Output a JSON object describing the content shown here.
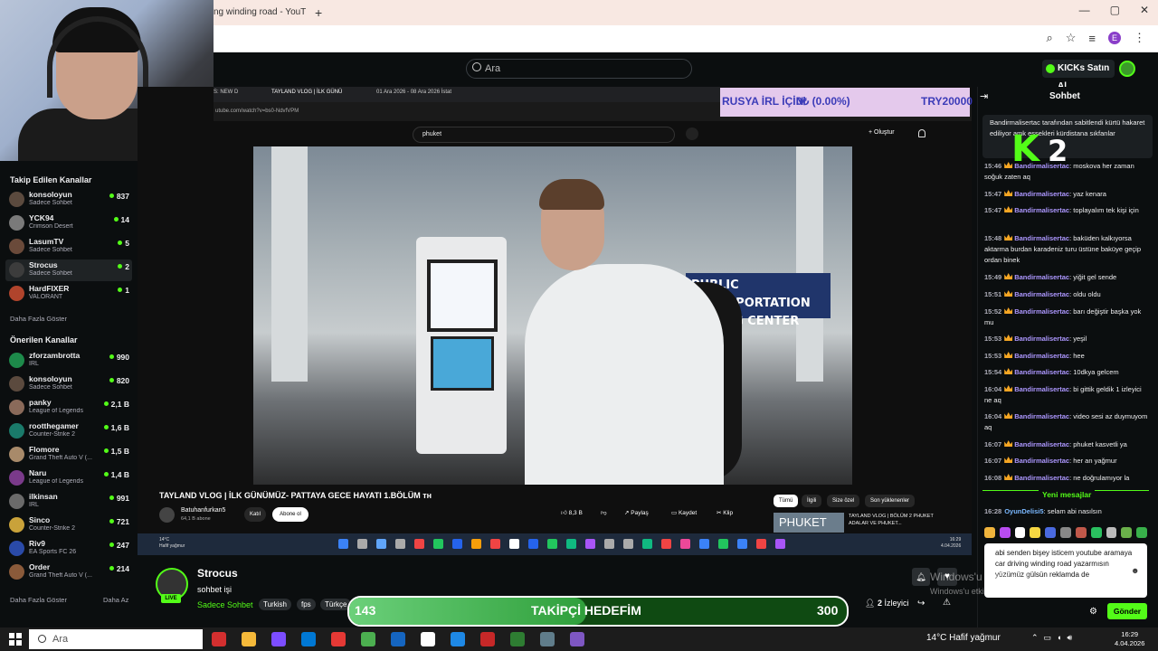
{
  "browser": {
    "tab_title": "ng winding road - YouT",
    "tab_close": "×",
    "new_tab": "+",
    "controls": [
      "—",
      "▢",
      "✕"
    ],
    "profile_initial": "E"
  },
  "kick": {
    "search_placeholder": "Ara",
    "kicks_button": "KICKs Satın Al"
  },
  "sidebar": {
    "followed_heading": "Takip Edilen Kanallar",
    "followed": [
      {
        "name": "konsoloyun",
        "category": "Sadece Sohbet",
        "viewers": "837",
        "color": "#5b4a3e"
      },
      {
        "name": "YCK94",
        "category": "Crimson Desert",
        "viewers": "14",
        "color": "#7a7a7a"
      },
      {
        "name": "LasumTV",
        "category": "Sadece Sohbet",
        "viewers": "5",
        "color": "#6a4a3a"
      },
      {
        "name": "Strocus",
        "category": "Sadece Sohbet",
        "viewers": "2",
        "color": "#3c3c3c"
      },
      {
        "name": "HardFIXER",
        "category": "VALORANT",
        "viewers": "1",
        "color": "#b0442c"
      }
    ],
    "show_more": "Daha Fazla Göster",
    "recommended_heading": "Önerilen Kanallar",
    "recommended": [
      {
        "name": "zforzambrotta",
        "category": "IRL",
        "viewers": "990",
        "color": "#1d8a4a"
      },
      {
        "name": "konsoloyun",
        "category": "Sadece Sohbet",
        "viewers": "820",
        "color": "#5b4a3e"
      },
      {
        "name": "panky",
        "category": "League of Legends",
        "viewers": "2,1 B",
        "color": "#8a6a5a"
      },
      {
        "name": "rootthegamer",
        "category": "Counter-Strike 2",
        "viewers": "1,6 B",
        "color": "#1a7a6a"
      },
      {
        "name": "Flomore",
        "category": "Grand Theft Auto V (...",
        "viewers": "1,5 B",
        "color": "#a88a6a"
      },
      {
        "name": "Naru",
        "category": "League of Legends",
        "viewers": "1,4 B",
        "color": "#7a3a8a"
      },
      {
        "name": "ilkinsan",
        "category": "IRL",
        "viewers": "991",
        "color": "#6a6a6a"
      },
      {
        "name": "Sinco",
        "category": "Counter-Strike 2",
        "viewers": "721",
        "color": "#c9a23a"
      },
      {
        "name": "Riv9",
        "category": "EA Sports FC 26",
        "viewers": "247",
        "color": "#2a4aa8"
      },
      {
        "name": "Order",
        "category": "Grand Theft Auto V (...",
        "viewers": "214",
        "color": "#8a5a3a"
      }
    ],
    "show_more_2": "Daha Fazla Göster",
    "show_less": "Daha Az"
  },
  "inner_browser": {
    "tabs": [
      "S: NEW D",
      "TAYLAND VLOG | İLK GÜNÜ",
      "01 Ara 2026 - 08 Ara 2026 İstat"
    ],
    "url": "utube.com/watch?v=bs0-NdvfVPM",
    "yt_search": "phuket",
    "create": "+ Oluştur"
  },
  "goal_banner": {
    "left": "RUSYA İRL İÇİN",
    "mid": "0₺ (0.00%)",
    "right": "TRY20000"
  },
  "video": {
    "sign_text": "PUBLIC TRANSPORTATION COO NG CENTER",
    "title": "TAYLAND VLOG | İLK GÜNÜMÜZ- PATTAYA GECE HAYATI 1.BÖLÜM ᴛʜ",
    "channel": "Batuhanfurkan5",
    "subs": "64,1 B abone",
    "join": "Katıl",
    "subscribe": "Abone ol",
    "likes": "8,3 B",
    "share": "Paylaş",
    "save": "Kaydet",
    "clip": "Klip",
    "filters": [
      "Tümü",
      "İlgili",
      "Size özel",
      "Son yüklenenler"
    ],
    "next_thumb": "PHUKET",
    "next_title": "TAYLAND VLOG | BÖLÜM 2 PHUKET ADALAR VE PHUKET...",
    "inner_weather": "14°C\nHafif yağmur",
    "inner_clock": "16:29\n4.04.2026"
  },
  "chat": {
    "title": "Sohbet",
    "pinned": "Bandirmalisertac tarafından sabitlendi kürtü hakaret ediliyor amk eşşekleri kürdistana sıkfanlar",
    "messages": [
      {
        "time": "15:46",
        "user": "Bandirmalisertac",
        "text": "moskova her zaman soğuk zaten aq"
      },
      {
        "time": "15:47",
        "user": "Bandirmalisertac",
        "text": "yaz kenara"
      },
      {
        "time": "15:47",
        "user": "Bandirmalisertac",
        "text": "toplayalım tek kişi için"
      },
      {
        "time": "15:48",
        "user": "Bandirmalisertac",
        "text": "baküden kalkıyorsa aktarma burdan karadeniz turu üstüne baküye geçip ordan binek"
      },
      {
        "time": "15:49",
        "user": "Bandirmalisertac",
        "text": "yiğit gel sende"
      },
      {
        "time": "15:51",
        "user": "Bandirmalisertac",
        "text": "oldu oldu"
      },
      {
        "time": "15:52",
        "user": "Bandirmalisertac",
        "text": "barı değiştir başka yok mu"
      },
      {
        "time": "15:53",
        "user": "Bandirmalisertac",
        "text": "yeşil"
      },
      {
        "time": "15:53",
        "user": "Bandirmalisertac",
        "text": "hee"
      },
      {
        "time": "15:54",
        "user": "Bandirmalisertac",
        "text": "10dkya gelcem"
      },
      {
        "time": "16:04",
        "user": "Bandirmalisertac",
        "text": "bi gittik geldik 1 izleyici ne aq"
      },
      {
        "time": "16:04",
        "user": "Bandirmalisertac",
        "text": "video sesi az duymuyom aq"
      },
      {
        "time": "16:07",
        "user": "Bandirmalisertac",
        "text": "phuket kasvetli ya"
      },
      {
        "time": "16:07",
        "user": "Bandirmalisertac",
        "text": "her an yağmur"
      },
      {
        "time": "16:08",
        "user": "Bandirmalisertac",
        "text": "ne doğrulamıyor la"
      }
    ],
    "new_messages": "Yeni mesajlar",
    "last_message": {
      "time": "16:28",
      "user": "OyunDelisi5",
      "text": "selam abi nasılsın"
    },
    "input_text": "abi senden bişey isticem youtube aramaya car driving winding road yazarmısın yüzümüz gülsün reklamda de",
    "send": "Gönder",
    "k2_k": "K",
    "k2_2": "2"
  },
  "channel": {
    "name": "Strocus",
    "title": "sohbet işi",
    "category": "Sadece Sohbet",
    "tags": [
      "Turkish",
      "fps",
      "Türkçe"
    ],
    "live": "LIVE",
    "viewers": "2",
    "viewers_label": "İzleyici",
    "win_activate": "Windows'u Etkinleştir",
    "win_activate_sub": "Windows'u etkinleştirmek için Ayarlar'a gidin."
  },
  "follow_goal": {
    "current": "143",
    "label": "TAKİPÇİ HEDEFİM",
    "target": "300",
    "progress": 0.477
  },
  "taskbar": {
    "search": "Ara",
    "weather": "14°C  Hafif yağmur",
    "time": "16:29",
    "date": "4.04.2026"
  }
}
